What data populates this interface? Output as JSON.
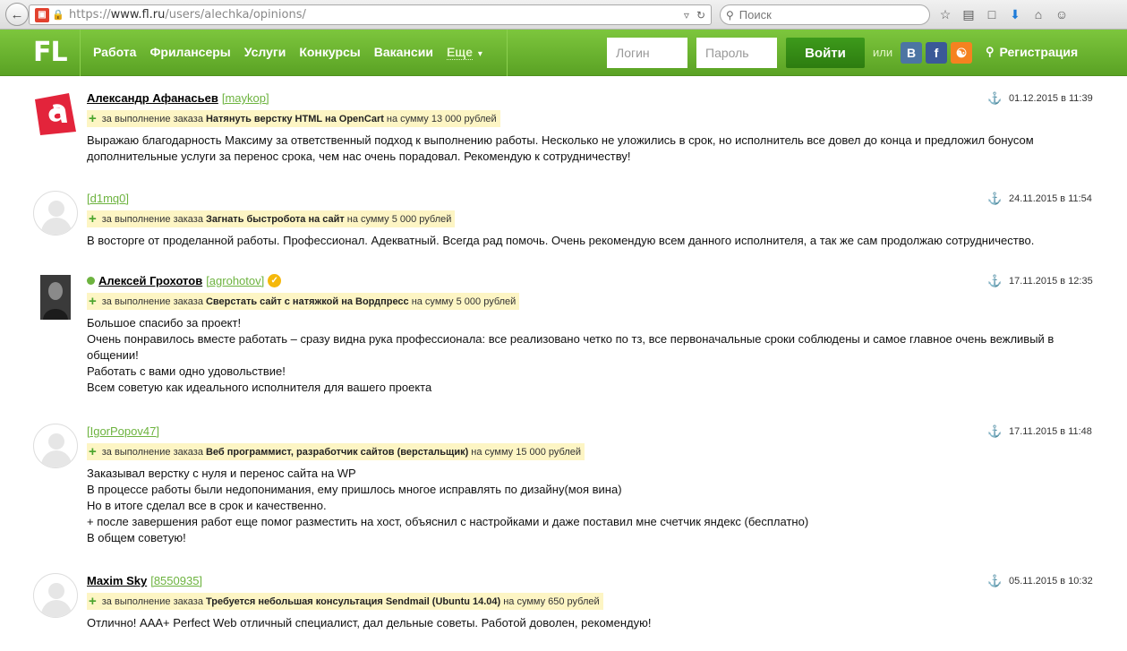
{
  "browser": {
    "url_proto": "https://",
    "url_host": "www.fl.ru",
    "url_path": "/users/alechka/opinions/",
    "search_placeholder": "Поиск"
  },
  "header": {
    "logo": "FL",
    "nav": [
      "Работа",
      "Фрилансеры",
      "Услуги",
      "Конкурсы",
      "Вакансии"
    ],
    "more": "Еще",
    "login_placeholder": "Логин",
    "password_placeholder": "Пароль",
    "login_button": "Войти",
    "or": "или",
    "social": {
      "vk": "В",
      "fb": "f",
      "ok": "Ок"
    },
    "register": "Регистрация"
  },
  "reviews": [
    {
      "name": "Александр Афанасьев",
      "login": "[maykop]",
      "date": "01.12.2015 в 11:39",
      "order_prefix": "за выполнение заказа",
      "order_title": "Натянуть верстку HTML на OpenCart",
      "order_sum": "на сумму 13 000 рублей",
      "text": "Выражаю благодарность Максиму за ответственный подход к выполнению работы. Несколько не уложились в срок, но исполнитель все довел до конца и предложил бонусом дополнительные услуги за перенос срока, чем нас очень порадовал. Рекомендую к сотрудничеству!"
    },
    {
      "name": "",
      "login": "[d1mq0]",
      "date": "24.11.2015 в 11:54",
      "order_prefix": "за выполнение заказа",
      "order_title": "Загнать быстробота на сайт",
      "order_sum": "на сумму 5 000 рублей",
      "text": "В восторге от проделанной работы. Профессионал. Адекватный. Всегда рад помочь. Очень рекомендую всем данного исполнителя, а так же сам продолжаю сотрудничество."
    },
    {
      "name": "Алексей Грохотов",
      "login": "[agrohotov]",
      "date": "17.11.2015 в 12:35",
      "order_prefix": "за выполнение заказа",
      "order_title": "Сверстать сайт с натяжкой на Вордпресс",
      "order_sum": "на сумму 5 000 рублей",
      "text": "Большое спасибо за проект!\nОчень понравилось вместе работать – сразу видна рука профессионала: все реализовано четко по тз, все первоначальные сроки соблюдены и самое главное очень вежливый в общении!\nРаботать с вами одно удовольствие!\nВсем советую как идеального исполнителя для вашего проекта"
    },
    {
      "name": "",
      "login": "[IgorPopov47]",
      "date": "17.11.2015 в 11:48",
      "order_prefix": "за выполнение заказа",
      "order_title": "Веб программист, разработчик сайтов (верстальщик)",
      "order_sum": "на сумму 15 000 рублей",
      "text": "Заказывал верстку с нуля и перенос сайта на WP\nВ процессе работы были недопонимания, ему пришлось многое исправлять по дизайну(моя вина)\nНо в итоге сделал все в срок и качественно.\n+ после завершения работ еще помог разместить на хост, объяснил с настройками и даже поставил мне счетчик яндекс (бесплатно)\nВ общем советую!"
    },
    {
      "name": "Maxim Sky",
      "login": "[8550935]",
      "date": "05.11.2015 в 10:32",
      "order_prefix": "за выполнение заказа",
      "order_title": "Требуется небольшая консультация Sendmail (Ubuntu 14.04)",
      "order_sum": "на сумму 650 рублей",
      "text": "Отлично! AAA+ Perfect Web отличный специалист, дал дельные советы. Работой доволен, рекомендую!"
    }
  ]
}
